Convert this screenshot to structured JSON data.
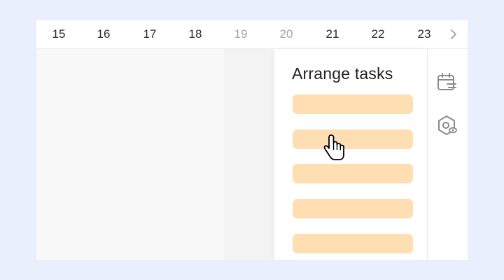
{
  "date_strip": {
    "days": [
      "15",
      "16",
      "17",
      "18",
      "19",
      "20",
      "21",
      "22",
      "23"
    ],
    "weekend_days": [
      "19",
      "20"
    ],
    "next_icon": "chevron-right-icon"
  },
  "panel": {
    "title": "Arrange tasks",
    "task_bar_count": 5,
    "task_bar_color": "#ffdfb2"
  },
  "side_toolbar": {
    "icons": [
      "calendar-icon",
      "settings-view-icon"
    ]
  },
  "colors": {
    "background": "#e9effd",
    "weekday_column": "#f8f8f8",
    "weekend_column": "#f3f3f3",
    "weekend_text": "#a4a4a4",
    "icon": "#8a8a8a"
  },
  "cursor": "hand-pointer-icon"
}
